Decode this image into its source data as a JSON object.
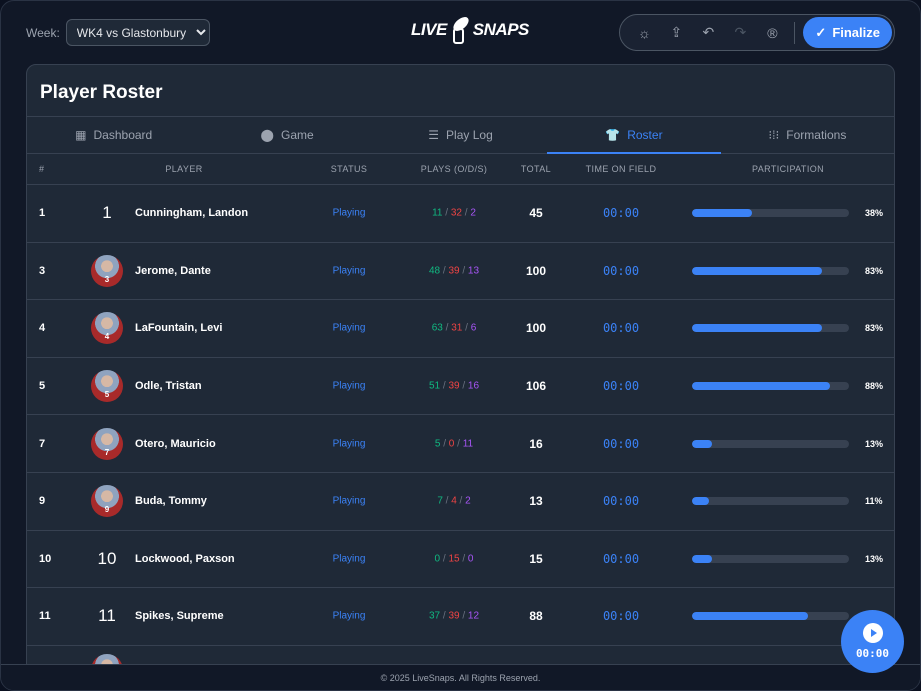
{
  "header": {
    "week_label": "Week:",
    "week_value": "WK4 vs Glastonbury",
    "logo_text": [
      "LIVE",
      "SNAPS"
    ],
    "finalize_label": "Finalize"
  },
  "page_title": "Player Roster",
  "tabs": [
    {
      "label": "Dashboard",
      "icon": "dashboard-icon"
    },
    {
      "label": "Game",
      "icon": "helmet-icon"
    },
    {
      "label": "Play Log",
      "icon": "list-icon"
    },
    {
      "label": "Roster",
      "icon": "jersey-icon",
      "active": true
    },
    {
      "label": "Formations",
      "icon": "formation-icon"
    }
  ],
  "columns": [
    "#",
    "PLAYER",
    "STATUS",
    "PLAYS (O/D/S)",
    "TOTAL",
    "TIME ON FIELD",
    "PARTICIPATION"
  ],
  "players": [
    {
      "num": "1",
      "photo": false,
      "name": "Cunningham, Landon",
      "status": "Playing",
      "o": "11",
      "d": "32",
      "s": "2",
      "total": "45",
      "time": "00:00",
      "pct": 38,
      "pct_label": "38%"
    },
    {
      "num": "3",
      "photo": true,
      "name": "Jerome, Dante",
      "status": "Playing",
      "o": "48",
      "d": "39",
      "s": "13",
      "total": "100",
      "time": "00:00",
      "pct": 83,
      "pct_label": "83%"
    },
    {
      "num": "4",
      "photo": true,
      "name": "LaFountain, Levi",
      "status": "Playing",
      "o": "63",
      "d": "31",
      "s": "6",
      "total": "100",
      "time": "00:00",
      "pct": 83,
      "pct_label": "83%"
    },
    {
      "num": "5",
      "photo": true,
      "name": "Odle, Tristan",
      "status": "Playing",
      "o": "51",
      "d": "39",
      "s": "16",
      "total": "106",
      "time": "00:00",
      "pct": 88,
      "pct_label": "88%"
    },
    {
      "num": "7",
      "photo": true,
      "name": "Otero, Mauricio",
      "status": "Playing",
      "o": "5",
      "d": "0",
      "s": "11",
      "total": "16",
      "time": "00:00",
      "pct": 13,
      "pct_label": "13%"
    },
    {
      "num": "9",
      "photo": true,
      "name": "Buda, Tommy",
      "status": "Playing",
      "o": "7",
      "d": "4",
      "s": "2",
      "total": "13",
      "time": "00:00",
      "pct": 11,
      "pct_label": "11%"
    },
    {
      "num": "10",
      "photo": false,
      "name": "Lockwood, Paxson",
      "status": "Playing",
      "o": "0",
      "d": "15",
      "s": "0",
      "total": "15",
      "time": "00:00",
      "pct": 13,
      "pct_label": "13%"
    },
    {
      "num": "11",
      "photo": false,
      "name": "Spikes, Supreme",
      "status": "Playing",
      "o": "37",
      "d": "39",
      "s": "12",
      "total": "88",
      "time": "00:00",
      "pct": 74,
      "pct_label": ""
    }
  ],
  "footer": "© 2025 LiveSnaps. All Rights Reserved.",
  "timer": {
    "time": "00:00"
  }
}
